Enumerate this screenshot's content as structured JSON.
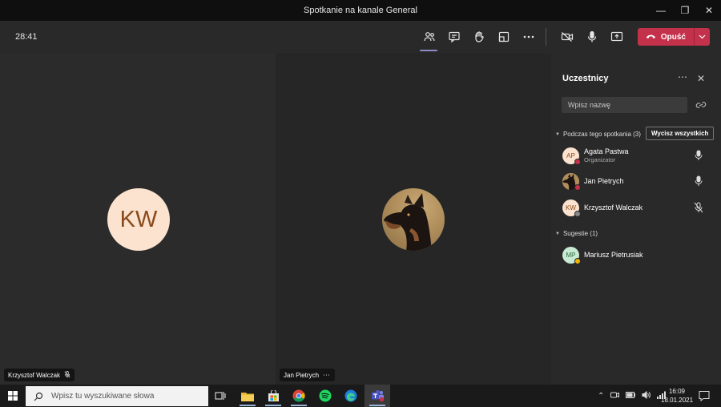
{
  "window": {
    "title": "Spotkanie na kanale General"
  },
  "toolbar": {
    "timer": "28:41",
    "leave_label": "Opuść"
  },
  "stage": {
    "tiles": [
      {
        "initials": "KW",
        "name": "Krzysztof Walczak"
      },
      {
        "name": "Jan Pietrych"
      }
    ]
  },
  "panel": {
    "title": "Uczestnicy",
    "search_placeholder": "Wpisz nazwę",
    "in_meeting_label": "Podczas tego spotkania (3)",
    "mute_all_label": "Wycisz wszystkich",
    "suggestions_label": "Sugestie (1)",
    "participants": [
      {
        "initials": "AP",
        "name": "Agata Pastwa",
        "role": "Organizator"
      },
      {
        "name": "Jan Pietrych"
      },
      {
        "initials": "KW",
        "name": "Krzysztof Walczak"
      }
    ],
    "suggestions": [
      {
        "initials": "MP",
        "name": "Mariusz Pietrusiak"
      }
    ]
  },
  "taskbar": {
    "search_placeholder": "Wpisz tu wyszukiwane słowa",
    "time": "16:09",
    "date": "18.01.2021"
  },
  "colors": {
    "leave": "#c4314b",
    "accent": "#8b8cc7",
    "kw_avatar": "#fbe3cf"
  }
}
